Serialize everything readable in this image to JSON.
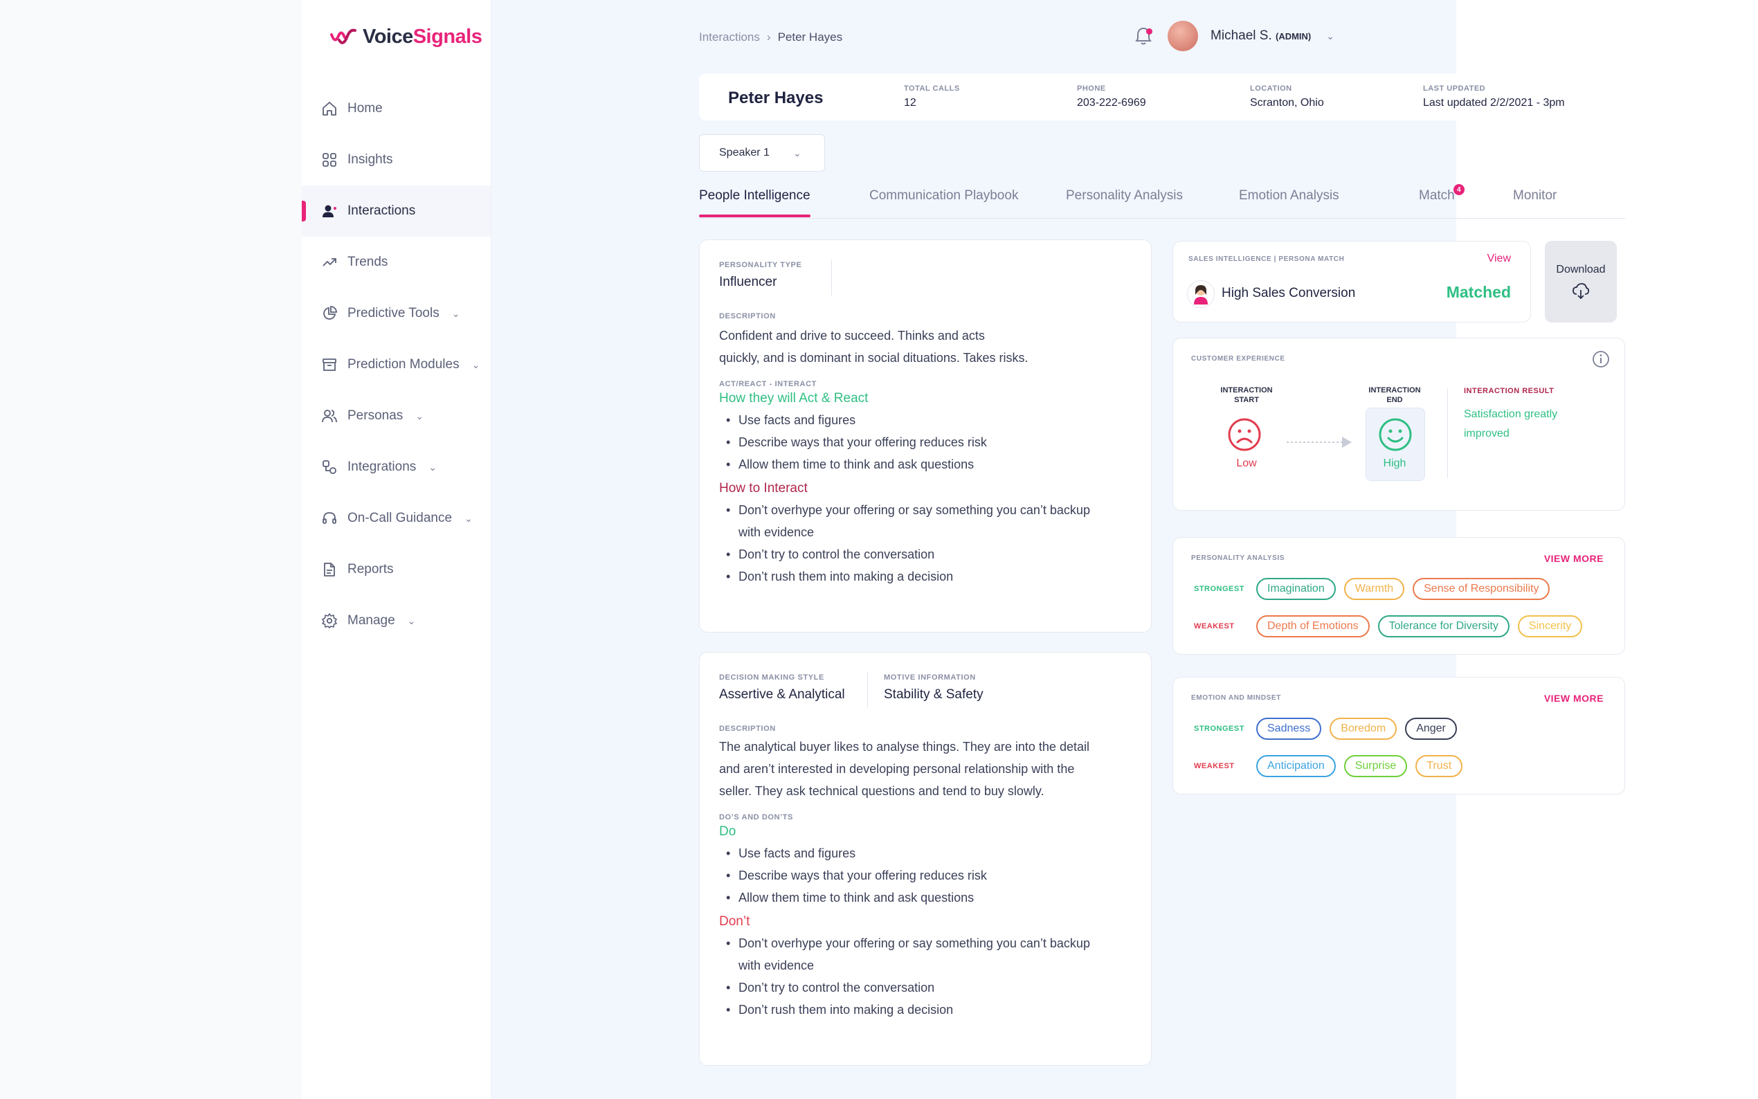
{
  "brand": {
    "name_part1": "Voice",
    "name_part2": "Signals",
    "accent": "#e8237a"
  },
  "sidebar": {
    "items": [
      {
        "label": "Home",
        "icon": "home-icon",
        "has_chevron": false,
        "active": false
      },
      {
        "label": "Insights",
        "icon": "grid-icon",
        "has_chevron": false,
        "active": false
      },
      {
        "label": "Interactions",
        "icon": "user-icon",
        "has_chevron": false,
        "active": true
      },
      {
        "label": "Trends",
        "icon": "trend-icon",
        "has_chevron": false,
        "active": false
      },
      {
        "label": "Predictive Tools",
        "icon": "pie-icon",
        "has_chevron": true,
        "active": false
      },
      {
        "label": "Prediction Modules",
        "icon": "archive-icon",
        "has_chevron": true,
        "active": false
      },
      {
        "label": "Personas",
        "icon": "users-icon",
        "has_chevron": true,
        "active": false
      },
      {
        "label": "Integrations",
        "icon": "integrations-icon",
        "has_chevron": true,
        "active": false
      },
      {
        "label": "On-Call Guidance",
        "icon": "headset-icon",
        "has_chevron": true,
        "active": false
      },
      {
        "label": "Reports",
        "icon": "document-icon",
        "has_chevron": false,
        "active": false
      },
      {
        "label": "Manage",
        "icon": "gear-icon",
        "has_chevron": true,
        "active": false
      }
    ]
  },
  "header": {
    "breadcrumb": {
      "parent": "Interactions",
      "current": "Peter Hayes"
    },
    "user": {
      "name": "Michael S.",
      "role": "(ADMIN)"
    }
  },
  "profile": {
    "name": "Peter Hayes",
    "fields": [
      {
        "label": "TOTAL CALLS",
        "value": "12"
      },
      {
        "label": "PHONE",
        "value": "203-222-6969"
      },
      {
        "label": "LOCATION",
        "value": "Scranton, Ohio"
      },
      {
        "label": "LAST UPDATED",
        "value": "Last updated 2/2/2021 - 3pm"
      }
    ]
  },
  "speaker_select": {
    "value": "Speaker 1"
  },
  "tabs": [
    {
      "label": "People Intelligence",
      "active": true
    },
    {
      "label": "Communication Playbook",
      "active": false
    },
    {
      "label": "Personality Analysis",
      "active": false
    },
    {
      "label": "Emotion Analysis",
      "active": false
    },
    {
      "label": "Match",
      "active": false,
      "badge": "4"
    },
    {
      "label": "Monitor",
      "active": false
    }
  ],
  "personality_card": {
    "type_label": "PERSONALITY TYPE",
    "type_value": "Influencer",
    "desc_label": "DESCRIPTION",
    "desc_line1": "Confident and drive to succeed.  Thinks and acts",
    "desc_line2": "quickly, and is dominant in social dituations.  Takes risks.",
    "act_label": "ACT/REACT - INTERACT",
    "act_heading": "How they will Act & React",
    "act_items": [
      "Use facts and figures",
      "Describe ways that your offering reduces risk",
      "Allow them time to think and ask questions"
    ],
    "interact_heading": "How to Interact",
    "interact_items": [
      "Don’t overhype your offering or say something you can’t backup",
      "with evidence",
      "Don’t try to control the conversation",
      "Don’t rush them into making a decision"
    ]
  },
  "decision_card": {
    "style_label": "DECISION MAKING STYLE",
    "style_value": "Assertive & Analytical",
    "motive_label": "MOTIVE INFORMATION",
    "motive_value": "Stability & Safety",
    "desc_label": "DESCRIPTION",
    "desc_line1": "The analytical buyer likes to analyse things. They are into the detail",
    "desc_line2": "and aren’t interested in developing personal relationship with the",
    "desc_line3": "seller. They ask technical questions and tend to buy slowly.",
    "dos_label": "DO’S AND DON’TS",
    "do_heading": "Do",
    "do_items": [
      "Use facts and figures",
      "Describe ways that your offering reduces risk",
      "Allow them time to think and ask questions"
    ],
    "dont_heading": "Don’t",
    "dont_items": [
      "Don’t overhype your offering or say something you can’t backup",
      "with evidence",
      "Don’t try to control the conversation",
      "Don’t rush them into making a decision"
    ]
  },
  "sales_card": {
    "label": "SALES INTELLIGENCE | PERSONA MATCH",
    "view": "View",
    "title": "High Sales Conversion",
    "status": "Matched"
  },
  "download": {
    "label": "Download"
  },
  "cx_card": {
    "label": "CUSTOMER EXPERIENCE",
    "start_label_1": "INTERACTION",
    "start_label_2": "START",
    "start_value": "Low",
    "end_label_1": "INTERACTION",
    "end_label_2": "END",
    "end_value": "High",
    "result_label": "INTERACTION RESULT",
    "result_line1": "Satisfaction greatly",
    "result_line2": "improved"
  },
  "personality_analysis": {
    "label": "PERSONALITY ANALYSIS",
    "view_more": "VIEW MORE",
    "strongest_label": "STRONGEST",
    "weakest_label": "WEAKEST",
    "strongest": [
      {
        "text": "Imagination",
        "color": "#2fa886"
      },
      {
        "text": "Warmth",
        "color": "#f2b24a"
      },
      {
        "text": "Sense of Responsibility",
        "color": "#ec7a4d"
      }
    ],
    "weakest": [
      {
        "text": "Depth of Emotions",
        "color": "#ec7a4d"
      },
      {
        "text": "Tolerance for Diversity",
        "color": "#2fa886"
      },
      {
        "text": "Sincerity",
        "color": "#f2c14a"
      }
    ]
  },
  "emotion_mindset": {
    "label": "EMOTION AND MINDSET",
    "view_more": "VIEW MORE",
    "strongest_label": "STRONGEST",
    "weakest_label": "WEAKEST",
    "strongest": [
      {
        "text": "Sadness",
        "color": "#3f6fd0"
      },
      {
        "text": "Boredom",
        "color": "#f2b24a"
      },
      {
        "text": "Anger",
        "color": "#3a3f57"
      }
    ],
    "weakest": [
      {
        "text": "Anticipation",
        "color": "#3ba3e0"
      },
      {
        "text": "Surprise",
        "color": "#6fcf3a"
      },
      {
        "text": "Trust",
        "color": "#f2b24a"
      }
    ]
  }
}
